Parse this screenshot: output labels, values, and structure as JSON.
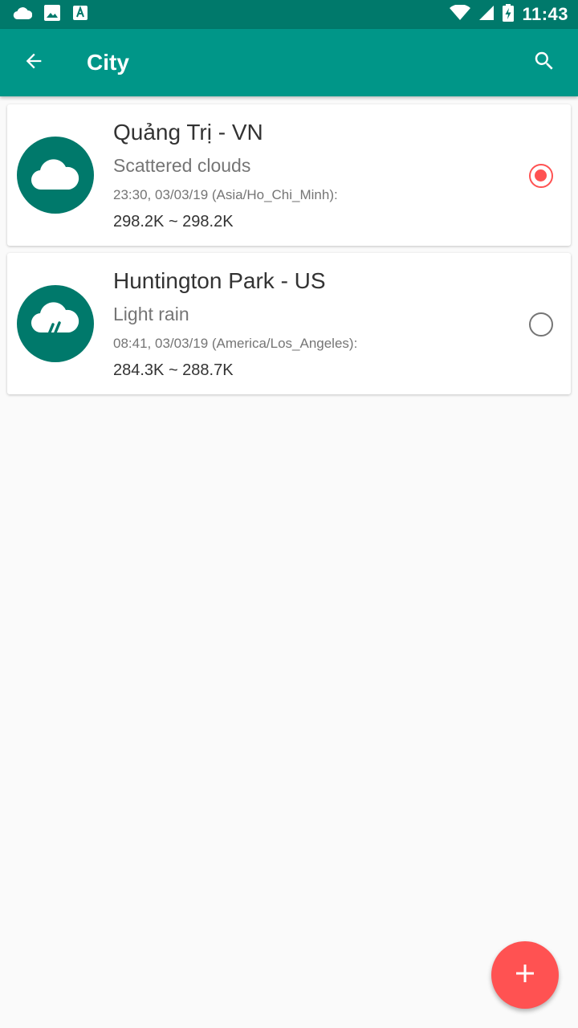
{
  "status_bar": {
    "time": "11:43",
    "left_icons": [
      "cloud-icon",
      "image-icon",
      "font-icon"
    ],
    "right_icons": [
      "wifi-icon",
      "signal-icon",
      "battery-charging-icon"
    ]
  },
  "app_bar": {
    "title": "City",
    "back_icon": "arrow-left-icon",
    "search_icon": "search-icon"
  },
  "cities": [
    {
      "name": "Quảng Trị - VN",
      "description": "Scattered clouds",
      "time": "23:30, 03/03/19 (Asia/Ho_Chi_Minh):",
      "temperature": "298.2K ~ 298.2K",
      "icon": "cloud-icon",
      "selected": true
    },
    {
      "name": "Huntington Park - US",
      "description": "Light rain",
      "time": "08:41, 03/03/19 (America/Los_Angeles):",
      "temperature": "284.3K ~ 288.7K",
      "icon": "rain-cloud-icon",
      "selected": false
    }
  ],
  "fab": {
    "icon": "plus-icon"
  },
  "colors": {
    "primary": "#009688",
    "primary_dark": "#00796b",
    "accent": "#ff5252"
  }
}
